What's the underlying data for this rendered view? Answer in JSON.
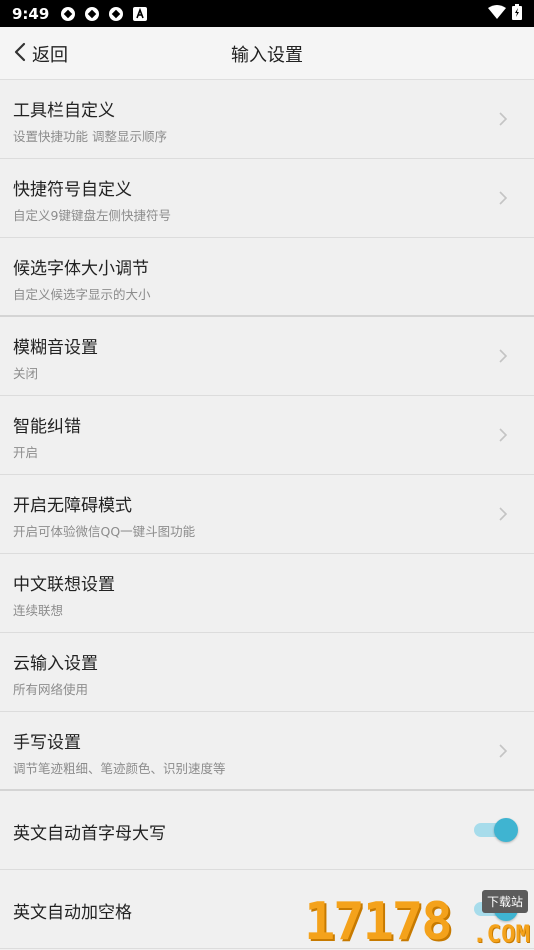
{
  "status_bar": {
    "time": "9:49",
    "icons": [
      "notification-icon",
      "notification-icon",
      "notification-icon",
      "text-a-icon"
    ],
    "right_icons": [
      "wifi-icon",
      "battery-charging-icon"
    ]
  },
  "header": {
    "back_label": "返回",
    "title": "输入设置"
  },
  "rows": [
    {
      "title": "工具栏自定义",
      "subtitle": "设置快捷功能 调整显示顺序",
      "chevron": true
    },
    {
      "title": "快捷符号自定义",
      "subtitle": "自定义9键键盘左侧快捷符号",
      "chevron": true
    },
    {
      "title": "候选字体大小调节",
      "subtitle": "自定义候选字显示的大小",
      "chevron": false
    },
    {
      "title": "模糊音设置",
      "subtitle": "关闭",
      "chevron": true
    },
    {
      "title": "智能纠错",
      "subtitle": "开启",
      "chevron": true
    },
    {
      "title": "开启无障碍模式",
      "subtitle": "开启可体验微信QQ一键斗图功能",
      "chevron": true
    },
    {
      "title": "中文联想设置",
      "subtitle": "连续联想",
      "chevron": false
    },
    {
      "title": "云输入设置",
      "subtitle": "所有网络使用",
      "chevron": false
    },
    {
      "title": "手写设置",
      "subtitle": "调节笔迹粗细、笔迹颜色、识别速度等",
      "chevron": true
    }
  ],
  "toggles": [
    {
      "title": "英文自动首字母大写",
      "on": true
    },
    {
      "title": "英文自动加空格",
      "on": true
    }
  ],
  "watermark": {
    "digits": "17178",
    "tag": "下载站",
    "domain": ".COM"
  },
  "colors": {
    "accent": "#3fb4d1",
    "accent_track": "#a7dceb",
    "background": "#f0f0f0"
  }
}
